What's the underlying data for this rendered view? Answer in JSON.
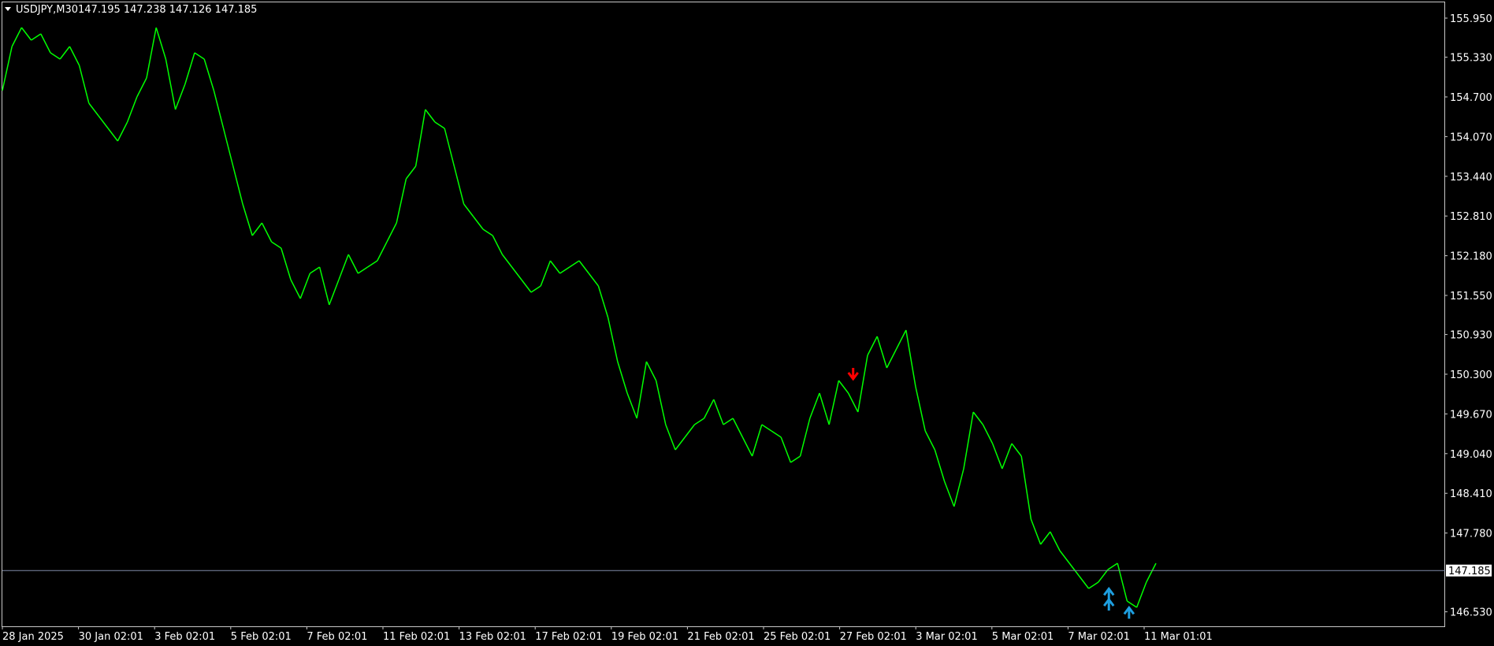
{
  "header": {
    "symbol": "USDJPY,M30",
    "ohlc": "147.195 147.238 147.126 147.185"
  },
  "colors": {
    "background": "#000000",
    "frame": "#c8c8c8",
    "price_line": "#00ff00",
    "bid_line": "#7f8aa8",
    "sell_arrow": "#ff0000",
    "buy_arrow": "#1e9fe0",
    "text": "#ffffff"
  },
  "chart_data": {
    "type": "line",
    "symbol": "USDJPY",
    "timeframe": "M30",
    "ylim": [
      146.3,
      156.2
    ],
    "current_price": 147.185,
    "current_price_label": "147.185",
    "y_ticks": [
      "155.950",
      "155.330",
      "154.700",
      "154.070",
      "153.440",
      "152.810",
      "152.180",
      "151.550",
      "150.930",
      "150.300",
      "149.670",
      "149.040",
      "148.410",
      "147.780",
      "146.530"
    ],
    "x_ticks": [
      "28 Jan 2025",
      "30 Jan 02:01",
      "3 Feb 02:01",
      "5 Feb 02:01",
      "7 Feb 02:01",
      "11 Feb 02:01",
      "13 Feb 02:01",
      "17 Feb 02:01",
      "19 Feb 02:01",
      "21 Feb 02:01",
      "25 Feb 02:01",
      "27 Feb 02:01",
      "3 Mar 02:01",
      "5 Mar 02:01",
      "7 Mar 02:01",
      "11 Mar 01:01"
    ],
    "x_range": [
      0,
      1500
    ],
    "series": [
      {
        "x": [
          0,
          10,
          20,
          30,
          40,
          50,
          60,
          70,
          80,
          90,
          100,
          110,
          120,
          130,
          140,
          150,
          160,
          170,
          180,
          190,
          200,
          210,
          220,
          230,
          240,
          250,
          260,
          270,
          280,
          290,
          300,
          310,
          320,
          330,
          340,
          350,
          360,
          370,
          380,
          390,
          400,
          410,
          420,
          430,
          440,
          450,
          460,
          470,
          480,
          490,
          500,
          510,
          520,
          530,
          540,
          550,
          560,
          570,
          580,
          590,
          600,
          610,
          620,
          630,
          640,
          650,
          660,
          670,
          680,
          690,
          700,
          710,
          720,
          730,
          740,
          750,
          760,
          770,
          780,
          790,
          800,
          810,
          820,
          830,
          840,
          850,
          860,
          870,
          880,
          890,
          900,
          910,
          920,
          930,
          940,
          950,
          960,
          970,
          980,
          990,
          1000,
          1010,
          1020,
          1030,
          1040,
          1050,
          1060,
          1070,
          1080,
          1090,
          1100,
          1110,
          1120,
          1130,
          1140,
          1150,
          1160,
          1170,
          1180,
          1190,
          1200
        ],
        "values": [
          154.8,
          155.5,
          155.8,
          155.6,
          155.7,
          155.4,
          155.3,
          155.5,
          155.2,
          154.6,
          154.4,
          154.2,
          154.0,
          154.3,
          154.7,
          155.0,
          155.8,
          155.3,
          154.5,
          154.9,
          155.4,
          155.3,
          154.8,
          154.2,
          153.6,
          153.0,
          152.5,
          152.7,
          152.4,
          152.3,
          151.8,
          151.5,
          151.9,
          152.0,
          151.4,
          151.8,
          152.2,
          151.9,
          152.0,
          152.1,
          152.4,
          152.7,
          153.4,
          153.6,
          154.5,
          154.3,
          154.2,
          153.6,
          153.0,
          152.8,
          152.6,
          152.5,
          152.2,
          152.0,
          151.8,
          151.6,
          151.7,
          152.1,
          151.9,
          152.0,
          152.1,
          151.9,
          151.7,
          151.2,
          150.5,
          150.0,
          149.6,
          150.5,
          150.2,
          149.5,
          149.1,
          149.3,
          149.5,
          149.6,
          149.9,
          149.5,
          149.6,
          149.3,
          149.0,
          149.5,
          149.4,
          149.3,
          148.9,
          149.0,
          149.6,
          150.0,
          149.5,
          150.2,
          150.0,
          149.7,
          150.6,
          150.9,
          150.4,
          150.7,
          151.0,
          150.1,
          149.4,
          149.1,
          148.6,
          148.2,
          148.8,
          149.7,
          149.5,
          149.2,
          148.8,
          149.2,
          149.0,
          148.0,
          147.6,
          147.8,
          147.5,
          147.3,
          147.1,
          146.9,
          147.0,
          147.2,
          147.3,
          146.7,
          146.6,
          147.0,
          147.3
        ]
      }
    ],
    "signals": [
      {
        "type": "sell",
        "x": 885,
        "value": 150.25
      },
      {
        "type": "buy",
        "x": 1151,
        "value": 146.82
      },
      {
        "type": "buy",
        "x": 1151,
        "value": 146.65
      },
      {
        "type": "buy",
        "x": 1172,
        "value": 146.52
      }
    ]
  }
}
